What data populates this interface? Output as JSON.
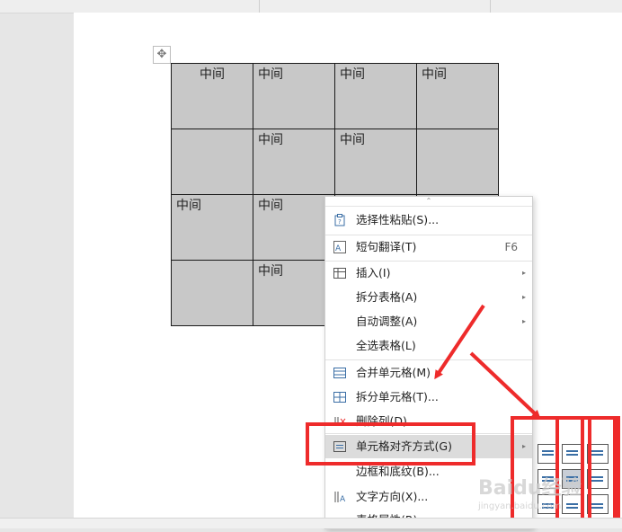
{
  "table": {
    "rows": [
      [
        "中间",
        "中间",
        "中间",
        "中间"
      ],
      [
        "",
        "中间",
        "中间",
        ""
      ],
      [
        "中间",
        "中间",
        "",
        ""
      ],
      [
        "",
        "中间",
        "",
        ""
      ]
    ]
  },
  "context_menu": {
    "items": [
      {
        "label": "选择性粘贴(S)...",
        "icon": "paste-special-icon",
        "shortcut": "",
        "submenu": false
      },
      {
        "label": "短句翻译(T)",
        "icon": "translate-icon",
        "shortcut": "F6",
        "submenu": false
      },
      {
        "label": "插入(I)",
        "icon": "table-insert-icon",
        "shortcut": "",
        "submenu": true
      },
      {
        "label": "拆分表格(A)",
        "icon": "",
        "shortcut": "",
        "submenu": true
      },
      {
        "label": "自动调整(A)",
        "icon": "",
        "shortcut": "",
        "submenu": true
      },
      {
        "label": "全选表格(L)",
        "icon": "",
        "shortcut": "",
        "submenu": false
      },
      {
        "label": "合并单元格(M)",
        "icon": "merge-cells-icon",
        "shortcut": "",
        "submenu": false
      },
      {
        "label": "拆分单元格(T)...",
        "icon": "split-cells-icon",
        "shortcut": "",
        "submenu": false
      },
      {
        "label": "删除列(D)",
        "icon": "delete-column-icon",
        "shortcut": "",
        "submenu": false
      },
      {
        "label": "单元格对齐方式(G)",
        "icon": "cell-align-icon",
        "shortcut": "",
        "submenu": true
      },
      {
        "label": "边框和底纹(B)...",
        "icon": "",
        "shortcut": "",
        "submenu": false
      },
      {
        "label": "文字方向(X)...",
        "icon": "text-direction-icon",
        "shortcut": "",
        "submenu": false
      },
      {
        "label": "表格属性(R)...",
        "icon": "",
        "shortcut": "",
        "submenu": false
      }
    ],
    "highlighted": "单元格对齐方式(G)"
  },
  "alignment_grid": {
    "options": [
      "top-left",
      "top-center",
      "top-right",
      "middle-left",
      "middle-center",
      "middle-right",
      "bottom-left",
      "bottom-center",
      "bottom-right"
    ],
    "selected": "middle-center"
  },
  "colors": {
    "accent": "#ee2b2b",
    "cell_bg": "#c8c8c8",
    "icon_blue": "#3a6ea5"
  },
  "watermark": {
    "brand": "Baidu经验",
    "url": "jingyan.baidu.com"
  }
}
